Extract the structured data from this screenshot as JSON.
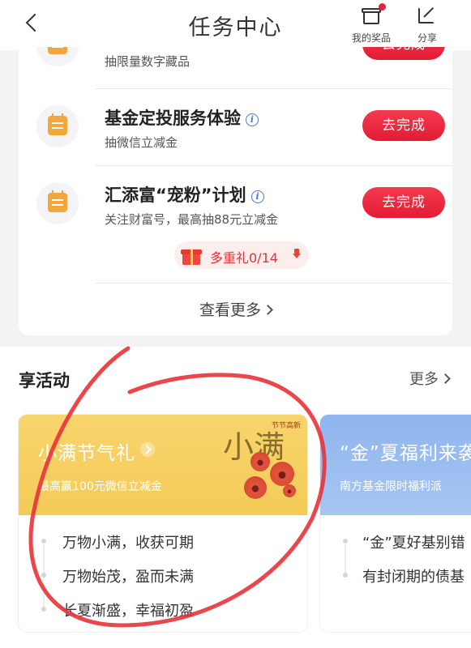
{
  "header": {
    "title": "任务中心",
    "my_prizes_label": "我的奖品",
    "share_label": "分享"
  },
  "tasks": [
    {
      "title": "",
      "subtitle": "抽限量数字藏品",
      "button": "去完成",
      "info": false
    },
    {
      "title": "基金定投服务体验",
      "subtitle": "抽微信立减金",
      "button": "去完成",
      "info": true
    },
    {
      "title": "汇添富“宠粉”计划",
      "subtitle": "关注财富号，最高抽88元立减金",
      "button": "去完成",
      "info": true
    }
  ],
  "multi_gift": {
    "label": "多重礼0/14"
  },
  "see_more": "查看更多",
  "activity_section": {
    "title": "享活动",
    "more": "更多",
    "cards": [
      {
        "title": "小满节气礼",
        "subtitle": "最高赢100元微信立减金",
        "art_tag": "节节高新",
        "art_char": "小满",
        "bullets": [
          "万物小满，收获可期",
          "万物始茂，盈而未满",
          "长夏渐盛，幸福初盈"
        ]
      },
      {
        "title": "“金”夏福利来袭",
        "subtitle": "南方基金限时福利派",
        "bullets": [
          "“金”夏好基别错",
          "有封闭期的债基"
        ]
      }
    ]
  },
  "colors": {
    "accent_red": "#e21c34",
    "task_icon": "#f3a63b",
    "card1_banner": "#f4cb58",
    "card2_banner": "#8fb5ee",
    "annotation": "#e8333a"
  }
}
